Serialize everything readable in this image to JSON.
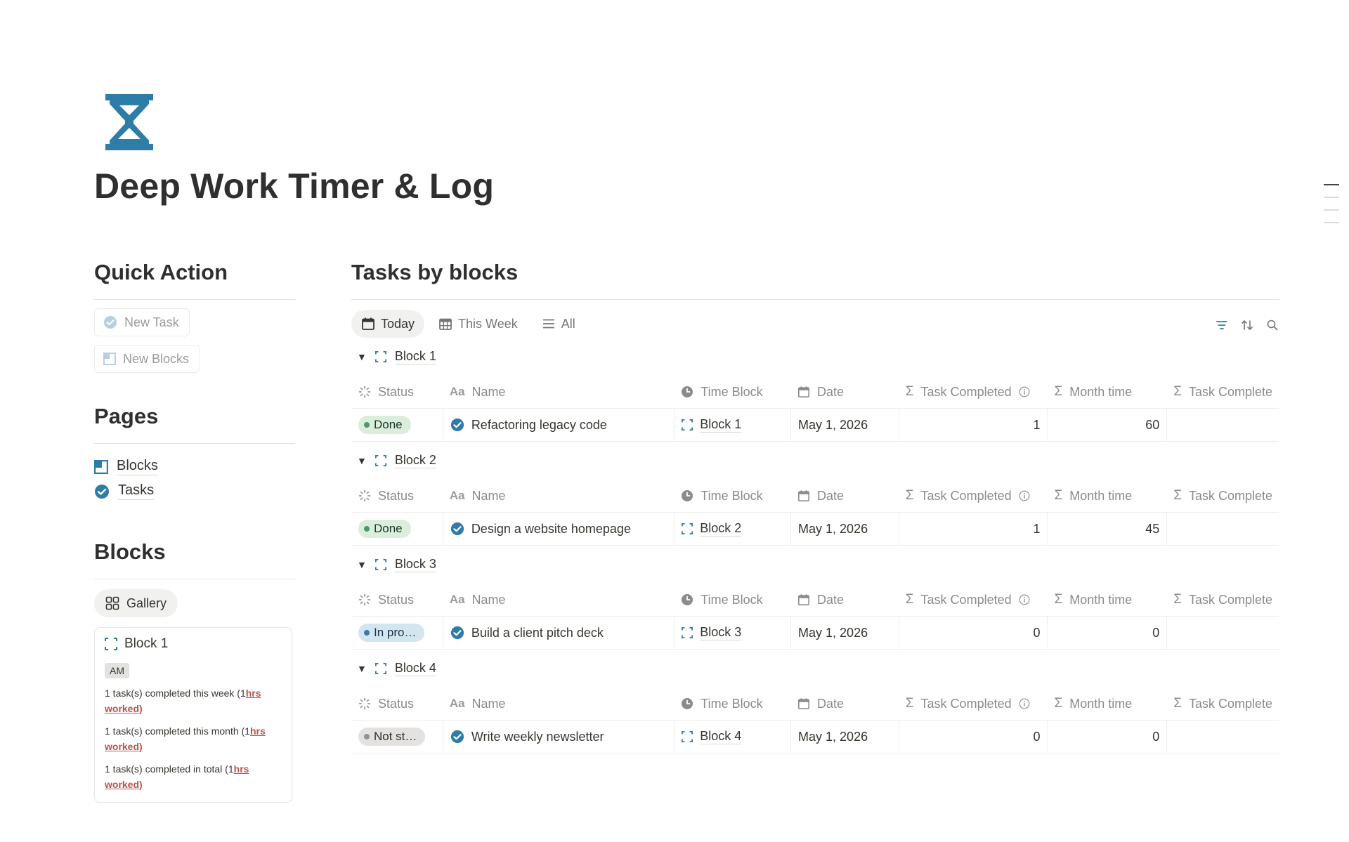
{
  "page": {
    "title": "Deep Work Timer & Log",
    "icon": "hourglass-icon",
    "accent": "#2e7ca8"
  },
  "quick_action": {
    "heading": "Quick Action",
    "buttons": [
      {
        "label": "New Task",
        "icon": "check-circle-icon"
      },
      {
        "label": "New Blocks",
        "icon": "block-icon"
      }
    ]
  },
  "pages": {
    "heading": "Pages",
    "items": [
      {
        "label": "Blocks",
        "icon": "block-icon"
      },
      {
        "label": "Tasks",
        "icon": "check-circle-icon"
      }
    ]
  },
  "blocks": {
    "heading": "Blocks",
    "view_label": "Gallery",
    "card": {
      "title": "Block 1",
      "tag": "AM",
      "lines": [
        {
          "text": "1 task(s) completed this week (1",
          "link": "hrs worked)"
        },
        {
          "text": "1 task(s) completed this month (1",
          "link": "hrs worked)"
        },
        {
          "text": "1 task(s) completed in total (1",
          "link": "hrs worked)"
        }
      ]
    }
  },
  "tasks": {
    "heading": "Tasks by blocks",
    "tabs": [
      {
        "label": "Today",
        "icon": "calendar-icon",
        "active": true
      },
      {
        "label": "This Week",
        "icon": "calendar-grid-icon",
        "active": false
      },
      {
        "label": "All",
        "icon": "list-icon",
        "active": false
      }
    ],
    "columns": [
      "Status",
      "Name",
      "Time Block",
      "Date",
      "Task Completed",
      "Month time",
      "Task Complete"
    ],
    "groups": [
      {
        "label": "Block 1",
        "rows": [
          {
            "status": "Done",
            "name": "Refactoring legacy code",
            "block": "Block 1",
            "date": "May 1, 2026",
            "completed": "1",
            "month_time": "60"
          }
        ]
      },
      {
        "label": "Block 2",
        "rows": [
          {
            "status": "Done",
            "name": "Design a website homepage",
            "block": "Block 2",
            "date": "May 1, 2026",
            "completed": "1",
            "month_time": "45"
          }
        ]
      },
      {
        "label": "Block 3",
        "rows": [
          {
            "status": "In pro…",
            "name": "Build a client pitch deck",
            "block": "Block 3",
            "date": "May 1, 2026",
            "completed": "0",
            "month_time": "0"
          }
        ]
      },
      {
        "label": "Block 4",
        "rows": [
          {
            "status": "Not st…",
            "name": "Write weekly newsletter",
            "block": "Block 4",
            "date": "May 1, 2026",
            "completed": "0",
            "month_time": "0"
          }
        ]
      }
    ],
    "status_colors": {
      "Done": {
        "bg": "#dbeddb",
        "dot": "#4f9768",
        "text": "#1c3829"
      },
      "In pro…": {
        "bg": "#d3e5ef",
        "dot": "#337ea9",
        "text": "#183347"
      },
      "Not st…": {
        "bg": "#e3e2e0",
        "dot": "#91918e",
        "text": "#32302c"
      }
    }
  }
}
